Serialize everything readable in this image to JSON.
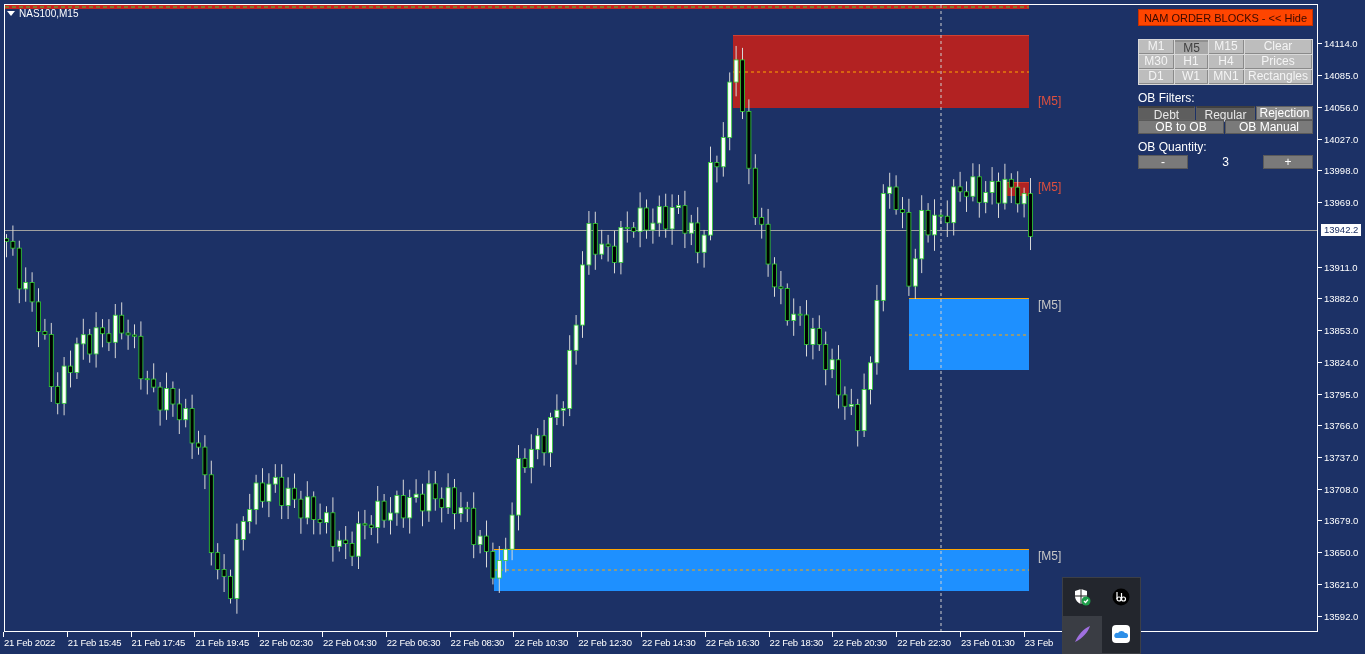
{
  "chart": {
    "symbol": "NAS100,M15",
    "current_price": "13942.2",
    "price_ticks": [
      "14114.0",
      "14085.0",
      "14056.0",
      "14027.0",
      "13998.0",
      "13969.0",
      "13911.0",
      "13882.0",
      "13853.0",
      "13824.0",
      "13795.0",
      "13766.0",
      "13737.0",
      "13708.0",
      "13679.0",
      "13650.0",
      "13621.0",
      "13592.0"
    ],
    "time_ticks": [
      "21 Feb 2022",
      "21 Feb 15:45",
      "21 Feb 17:45",
      "21 Feb 19:45",
      "22 Feb 02:30",
      "22 Feb 04:30",
      "22 Feb 06:30",
      "22 Feb 08:30",
      "22 Feb 10:30",
      "22 Feb 12:30",
      "22 Feb 14:30",
      "22 Feb 16:30",
      "22 Feb 18:30",
      "22 Feb 20:30",
      "22 Feb 22:30",
      "23 Feb 01:30",
      "23 Feb"
    ],
    "zones": [
      {
        "kind": "bearish",
        "label": "[M5]"
      },
      {
        "kind": "bearish",
        "label": "[M5]"
      },
      {
        "kind": "bullish",
        "label": "[M5]"
      },
      {
        "kind": "bullish",
        "label": "[M5]"
      }
    ]
  },
  "panel": {
    "title": "NAM ORDER BLOCKS - << Hide",
    "buttons": [
      {
        "label": "M1",
        "kind": "timeframe",
        "selected": false
      },
      {
        "label": "M5",
        "kind": "timeframe",
        "selected": true
      },
      {
        "label": "M15",
        "kind": "timeframe",
        "selected": false
      },
      {
        "label": "Clear",
        "kind": "action"
      },
      {
        "label": "M30",
        "kind": "timeframe",
        "selected": false
      },
      {
        "label": "H1",
        "kind": "timeframe",
        "selected": false
      },
      {
        "label": "H4",
        "kind": "timeframe",
        "selected": false
      },
      {
        "label": "Prices",
        "kind": "action"
      },
      {
        "label": "D1",
        "kind": "timeframe",
        "selected": false
      },
      {
        "label": "W1",
        "kind": "timeframe",
        "selected": false
      },
      {
        "label": "MN1",
        "kind": "timeframe",
        "selected": false
      },
      {
        "label": "Rectangles",
        "kind": "action"
      }
    ],
    "filters_label": "OB Filters:",
    "filters": [
      {
        "label": "Debt",
        "on": true
      },
      {
        "label": "Regular",
        "on": true
      },
      {
        "label": "Rejection",
        "on": false
      }
    ],
    "modes": [
      "OB to OB",
      "OB Manual"
    ],
    "quantity_label": "OB Quantity:",
    "decrease": "-",
    "quantity": "3",
    "increase": "+"
  },
  "tray_popup": {
    "icons": [
      {
        "kind": "shield",
        "hovered": false
      },
      {
        "kind": "sound",
        "hovered": false
      },
      {
        "kind": "feather",
        "hovered": true
      },
      {
        "kind": "cloud",
        "hovered": false
      }
    ]
  }
}
